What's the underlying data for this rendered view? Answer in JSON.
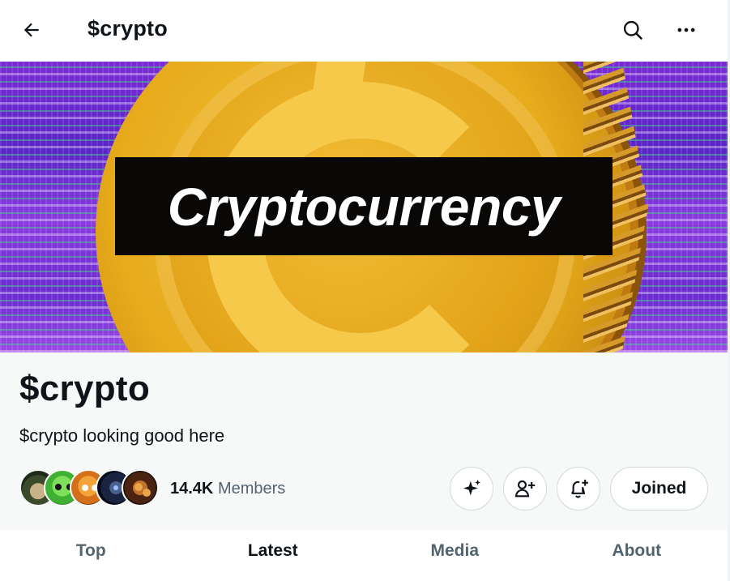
{
  "header": {
    "title": "$crypto",
    "back_icon": "arrow-left-icon",
    "search_icon": "search-icon",
    "more_icon": "more-horizontal-icon"
  },
  "banner": {
    "label": "Cryptocurrency"
  },
  "community": {
    "name": "$crypto",
    "description": "$crypto looking good here",
    "member_count": "14.4K",
    "member_label": "Members"
  },
  "actions": {
    "grok_icon": "sparkle-icon",
    "invite_icon": "add-user-icon",
    "notify_icon": "bell-plus-icon",
    "joined_label": "Joined"
  },
  "tabs": [
    {
      "label": "Top",
      "active": false
    },
    {
      "label": "Latest",
      "active": true
    },
    {
      "label": "Media",
      "active": false
    },
    {
      "label": "About",
      "active": false
    }
  ],
  "colors": {
    "text_primary": "#0f1419",
    "text_secondary": "#536471",
    "border": "#cfd9de",
    "info_background": "#f7f9f9"
  }
}
